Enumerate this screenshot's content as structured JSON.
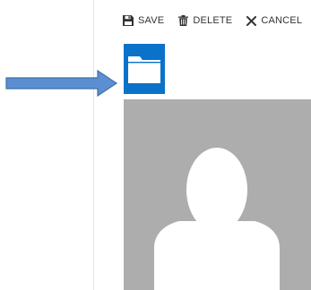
{
  "toolbar": {
    "save_label": "SAVE",
    "delete_label": "DELETE",
    "cancel_label": "CANCEL",
    "save_icon": "floppy-disk-icon",
    "delete_icon": "trash-icon",
    "cancel_icon": "close-icon"
  },
  "folder": {
    "icon": "folder-icon",
    "tile_color": "#0a72c9"
  },
  "annotation": {
    "icon": "right-arrow-icon",
    "color": "#5b8fd1"
  },
  "profile_photo": {
    "icon": "person-silhouette-icon",
    "background_color": "#adadad",
    "silhouette_color": "#ffffff"
  }
}
